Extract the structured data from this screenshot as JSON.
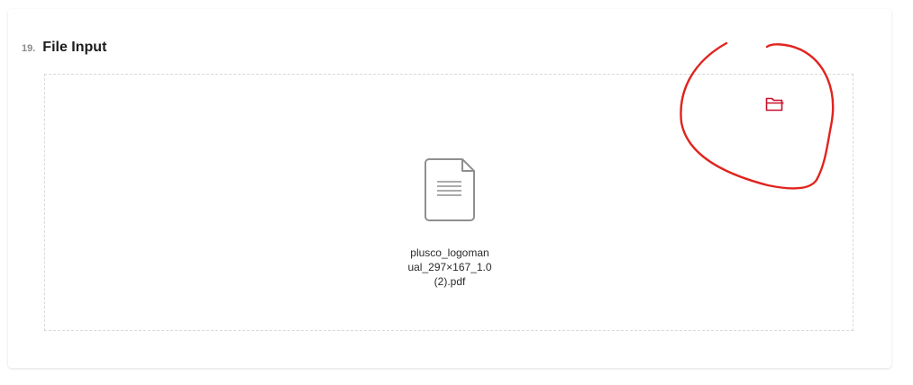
{
  "section": {
    "number": "19.",
    "title": "File Input"
  },
  "upload": {
    "browse_icon": "folder-open-icon",
    "file_icon": "document-icon",
    "file_name": "plusco_logomanual_297×167_1.0 (2).pdf"
  },
  "colors": {
    "accent": "#c8102e",
    "annotation": "#e0241e",
    "dropzone_border": "#d9d9d9",
    "file_icon_stroke": "#8f8f8f"
  }
}
